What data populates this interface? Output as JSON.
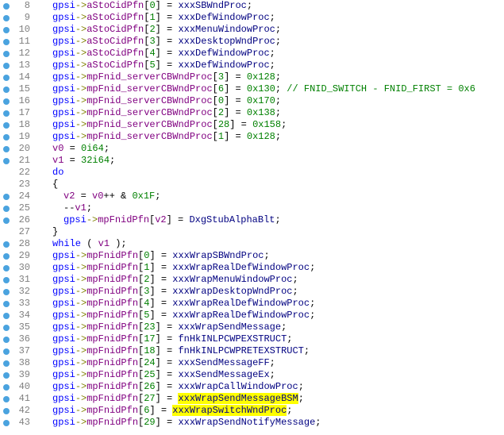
{
  "lines": [
    {
      "n": 8,
      "bp": true,
      "ind": 1,
      "tokens": [
        [
          "g",
          "gpsi"
        ],
        [
          "arr",
          "->"
        ],
        [
          "mem",
          "aStoCidPfn"
        ],
        [
          "op",
          "["
        ],
        [
          "num",
          "0"
        ],
        [
          "op",
          "] = "
        ],
        [
          "fn",
          "xxxSBWndProc"
        ],
        [
          "op",
          ";"
        ]
      ]
    },
    {
      "n": 9,
      "bp": true,
      "ind": 1,
      "tokens": [
        [
          "g",
          "gpsi"
        ],
        [
          "arr",
          "->"
        ],
        [
          "mem",
          "aStoCidPfn"
        ],
        [
          "op",
          "["
        ],
        [
          "num",
          "1"
        ],
        [
          "op",
          "] = "
        ],
        [
          "fn",
          "xxxDefWindowProc"
        ],
        [
          "op",
          ";"
        ]
      ]
    },
    {
      "n": 10,
      "bp": true,
      "ind": 1,
      "tokens": [
        [
          "g",
          "gpsi"
        ],
        [
          "arr",
          "->"
        ],
        [
          "mem",
          "aStoCidPfn"
        ],
        [
          "op",
          "["
        ],
        [
          "num",
          "2"
        ],
        [
          "op",
          "] = "
        ],
        [
          "fn",
          "xxxMenuWindowProc"
        ],
        [
          "op",
          ";"
        ]
      ]
    },
    {
      "n": 11,
      "bp": true,
      "ind": 1,
      "tokens": [
        [
          "g",
          "gpsi"
        ],
        [
          "arr",
          "->"
        ],
        [
          "mem",
          "aStoCidPfn"
        ],
        [
          "op",
          "["
        ],
        [
          "num",
          "3"
        ],
        [
          "op",
          "] = "
        ],
        [
          "fn",
          "xxxDesktopWndProc"
        ],
        [
          "op",
          ";"
        ]
      ]
    },
    {
      "n": 12,
      "bp": true,
      "ind": 1,
      "tokens": [
        [
          "g",
          "gpsi"
        ],
        [
          "arr",
          "->"
        ],
        [
          "mem",
          "aStoCidPfn"
        ],
        [
          "op",
          "["
        ],
        [
          "num",
          "4"
        ],
        [
          "op",
          "] = "
        ],
        [
          "fn",
          "xxxDefWindowProc"
        ],
        [
          "op",
          ";"
        ]
      ]
    },
    {
      "n": 13,
      "bp": true,
      "ind": 1,
      "tokens": [
        [
          "g",
          "gpsi"
        ],
        [
          "arr",
          "->"
        ],
        [
          "mem",
          "aStoCidPfn"
        ],
        [
          "op",
          "["
        ],
        [
          "num",
          "5"
        ],
        [
          "op",
          "] = "
        ],
        [
          "fn",
          "xxxDefWindowProc"
        ],
        [
          "op",
          ";"
        ]
      ]
    },
    {
      "n": 14,
      "bp": true,
      "ind": 1,
      "tokens": [
        [
          "g",
          "gpsi"
        ],
        [
          "arr",
          "->"
        ],
        [
          "mem",
          "mpFnid_serverCBWndProc"
        ],
        [
          "op",
          "["
        ],
        [
          "num",
          "3"
        ],
        [
          "op",
          "] = "
        ],
        [
          "num",
          "0x128"
        ],
        [
          "op",
          ";"
        ]
      ]
    },
    {
      "n": 15,
      "bp": true,
      "ind": 1,
      "tokens": [
        [
          "g",
          "gpsi"
        ],
        [
          "arr",
          "->"
        ],
        [
          "mem",
          "mpFnid_serverCBWndProc"
        ],
        [
          "op",
          "["
        ],
        [
          "num",
          "6"
        ],
        [
          "op",
          "] = "
        ],
        [
          "num",
          "0x130"
        ],
        [
          "op",
          ";"
        ],
        [
          "sp",
          "      "
        ],
        [
          "cm",
          "// FNID_SWITCH - FNID_FIRST = 0x6"
        ]
      ]
    },
    {
      "n": 16,
      "bp": true,
      "ind": 1,
      "tokens": [
        [
          "g",
          "gpsi"
        ],
        [
          "arr",
          "->"
        ],
        [
          "mem",
          "mpFnid_serverCBWndProc"
        ],
        [
          "op",
          "["
        ],
        [
          "num",
          "0"
        ],
        [
          "op",
          "] = "
        ],
        [
          "num",
          "0x170"
        ],
        [
          "op",
          ";"
        ]
      ]
    },
    {
      "n": 17,
      "bp": true,
      "ind": 1,
      "tokens": [
        [
          "g",
          "gpsi"
        ],
        [
          "arr",
          "->"
        ],
        [
          "mem",
          "mpFnid_serverCBWndProc"
        ],
        [
          "op",
          "["
        ],
        [
          "num",
          "2"
        ],
        [
          "op",
          "] = "
        ],
        [
          "num",
          "0x138"
        ],
        [
          "op",
          ";"
        ]
      ]
    },
    {
      "n": 18,
      "bp": true,
      "ind": 1,
      "tokens": [
        [
          "g",
          "gpsi"
        ],
        [
          "arr",
          "->"
        ],
        [
          "mem",
          "mpFnid_serverCBWndProc"
        ],
        [
          "op",
          "["
        ],
        [
          "num",
          "28"
        ],
        [
          "op",
          "] = "
        ],
        [
          "num",
          "0x158"
        ],
        [
          "op",
          ";"
        ]
      ]
    },
    {
      "n": 19,
      "bp": true,
      "ind": 1,
      "tokens": [
        [
          "g",
          "gpsi"
        ],
        [
          "arr",
          "->"
        ],
        [
          "mem",
          "mpFnid_serverCBWndProc"
        ],
        [
          "op",
          "["
        ],
        [
          "num",
          "1"
        ],
        [
          "op",
          "] = "
        ],
        [
          "num",
          "0x128"
        ],
        [
          "op",
          ";"
        ]
      ]
    },
    {
      "n": 20,
      "bp": true,
      "ind": 1,
      "tokens": [
        [
          "var",
          "v0"
        ],
        [
          "op",
          " = "
        ],
        [
          "num",
          "0i64"
        ],
        [
          "op",
          ";"
        ]
      ]
    },
    {
      "n": 21,
      "bp": true,
      "ind": 1,
      "tokens": [
        [
          "var",
          "v1"
        ],
        [
          "op",
          " = "
        ],
        [
          "num",
          "32i64"
        ],
        [
          "op",
          ";"
        ]
      ]
    },
    {
      "n": 22,
      "bp": false,
      "ind": 1,
      "tokens": [
        [
          "kw",
          "do"
        ]
      ]
    },
    {
      "n": 23,
      "bp": false,
      "ind": 1,
      "tokens": [
        [
          "op",
          "{"
        ]
      ]
    },
    {
      "n": 24,
      "bp": true,
      "ind": 2,
      "tokens": [
        [
          "var",
          "v2"
        ],
        [
          "op",
          " = "
        ],
        [
          "var",
          "v0"
        ],
        [
          "op",
          "++ & "
        ],
        [
          "num",
          "0x1F"
        ],
        [
          "op",
          ";"
        ]
      ]
    },
    {
      "n": 25,
      "bp": true,
      "ind": 2,
      "tokens": [
        [
          "op",
          "--"
        ],
        [
          "var",
          "v1"
        ],
        [
          "op",
          ";"
        ]
      ]
    },
    {
      "n": 26,
      "bp": true,
      "ind": 2,
      "tokens": [
        [
          "g",
          "gpsi"
        ],
        [
          "arr",
          "->"
        ],
        [
          "mem",
          "mpFnidPfn"
        ],
        [
          "op",
          "["
        ],
        [
          "var",
          "v2"
        ],
        [
          "op",
          "] = "
        ],
        [
          "fn",
          "DxgStubAlphaBlt"
        ],
        [
          "op",
          ";"
        ]
      ]
    },
    {
      "n": 27,
      "bp": false,
      "ind": 1,
      "tokens": [
        [
          "op",
          "}"
        ]
      ]
    },
    {
      "n": 28,
      "bp": true,
      "ind": 1,
      "tokens": [
        [
          "kw",
          "while"
        ],
        [
          "op",
          " ( "
        ],
        [
          "var",
          "v1"
        ],
        [
          "op",
          " );"
        ]
      ]
    },
    {
      "n": 29,
      "bp": true,
      "ind": 1,
      "tokens": [
        [
          "g",
          "gpsi"
        ],
        [
          "arr",
          "->"
        ],
        [
          "mem",
          "mpFnidPfn"
        ],
        [
          "op",
          "["
        ],
        [
          "num",
          "0"
        ],
        [
          "op",
          "] = "
        ],
        [
          "fn",
          "xxxWrapSBWndProc"
        ],
        [
          "op",
          ";"
        ]
      ]
    },
    {
      "n": 30,
      "bp": true,
      "ind": 1,
      "tokens": [
        [
          "g",
          "gpsi"
        ],
        [
          "arr",
          "->"
        ],
        [
          "mem",
          "mpFnidPfn"
        ],
        [
          "op",
          "["
        ],
        [
          "num",
          "1"
        ],
        [
          "op",
          "] = "
        ],
        [
          "fn",
          "xxxWrapRealDefWindowProc"
        ],
        [
          "op",
          ";"
        ]
      ]
    },
    {
      "n": 31,
      "bp": true,
      "ind": 1,
      "tokens": [
        [
          "g",
          "gpsi"
        ],
        [
          "arr",
          "->"
        ],
        [
          "mem",
          "mpFnidPfn"
        ],
        [
          "op",
          "["
        ],
        [
          "num",
          "2"
        ],
        [
          "op",
          "] = "
        ],
        [
          "fn",
          "xxxWrapMenuWindowProc"
        ],
        [
          "op",
          ";"
        ]
      ]
    },
    {
      "n": 32,
      "bp": true,
      "ind": 1,
      "tokens": [
        [
          "g",
          "gpsi"
        ],
        [
          "arr",
          "->"
        ],
        [
          "mem",
          "mpFnidPfn"
        ],
        [
          "op",
          "["
        ],
        [
          "num",
          "3"
        ],
        [
          "op",
          "] = "
        ],
        [
          "fn",
          "xxxWrapDesktopWndProc"
        ],
        [
          "op",
          ";"
        ]
      ]
    },
    {
      "n": 33,
      "bp": true,
      "ind": 1,
      "tokens": [
        [
          "g",
          "gpsi"
        ],
        [
          "arr",
          "->"
        ],
        [
          "mem",
          "mpFnidPfn"
        ],
        [
          "op",
          "["
        ],
        [
          "num",
          "4"
        ],
        [
          "op",
          "] = "
        ],
        [
          "fn",
          "xxxWrapRealDefWindowProc"
        ],
        [
          "op",
          ";"
        ]
      ]
    },
    {
      "n": 34,
      "bp": true,
      "ind": 1,
      "tokens": [
        [
          "g",
          "gpsi"
        ],
        [
          "arr",
          "->"
        ],
        [
          "mem",
          "mpFnidPfn"
        ],
        [
          "op",
          "["
        ],
        [
          "num",
          "5"
        ],
        [
          "op",
          "] = "
        ],
        [
          "fn",
          "xxxWrapRealDefWindowProc"
        ],
        [
          "op",
          ";"
        ]
      ]
    },
    {
      "n": 35,
      "bp": true,
      "ind": 1,
      "tokens": [
        [
          "g",
          "gpsi"
        ],
        [
          "arr",
          "->"
        ],
        [
          "mem",
          "mpFnidPfn"
        ],
        [
          "op",
          "["
        ],
        [
          "num",
          "23"
        ],
        [
          "op",
          "] = "
        ],
        [
          "fn",
          "xxxWrapSendMessage"
        ],
        [
          "op",
          ";"
        ]
      ]
    },
    {
      "n": 36,
      "bp": true,
      "ind": 1,
      "tokens": [
        [
          "g",
          "gpsi"
        ],
        [
          "arr",
          "->"
        ],
        [
          "mem",
          "mpFnidPfn"
        ],
        [
          "op",
          "["
        ],
        [
          "num",
          "17"
        ],
        [
          "op",
          "] = "
        ],
        [
          "fn",
          "fnHkINLPCWPEXSTRUCT"
        ],
        [
          "op",
          ";"
        ]
      ]
    },
    {
      "n": 37,
      "bp": true,
      "ind": 1,
      "tokens": [
        [
          "g",
          "gpsi"
        ],
        [
          "arr",
          "->"
        ],
        [
          "mem",
          "mpFnidPfn"
        ],
        [
          "op",
          "["
        ],
        [
          "num",
          "18"
        ],
        [
          "op",
          "] = "
        ],
        [
          "fn",
          "fnHkINLPCWPRETEXSTRUCT"
        ],
        [
          "op",
          ";"
        ]
      ]
    },
    {
      "n": 38,
      "bp": true,
      "ind": 1,
      "tokens": [
        [
          "g",
          "gpsi"
        ],
        [
          "arr",
          "->"
        ],
        [
          "mem",
          "mpFnidPfn"
        ],
        [
          "op",
          "["
        ],
        [
          "num",
          "24"
        ],
        [
          "op",
          "] = "
        ],
        [
          "fn",
          "xxxSendMessageFF"
        ],
        [
          "op",
          ";"
        ]
      ]
    },
    {
      "n": 39,
      "bp": true,
      "ind": 1,
      "tokens": [
        [
          "g",
          "gpsi"
        ],
        [
          "arr",
          "->"
        ],
        [
          "mem",
          "mpFnidPfn"
        ],
        [
          "op",
          "["
        ],
        [
          "num",
          "25"
        ],
        [
          "op",
          "] = "
        ],
        [
          "fn",
          "xxxSendMessageEx"
        ],
        [
          "op",
          ";"
        ]
      ]
    },
    {
      "n": 40,
      "bp": true,
      "ind": 1,
      "tokens": [
        [
          "g",
          "gpsi"
        ],
        [
          "arr",
          "->"
        ],
        [
          "mem",
          "mpFnidPfn"
        ],
        [
          "op",
          "["
        ],
        [
          "num",
          "26"
        ],
        [
          "op",
          "] = "
        ],
        [
          "fn",
          "xxxWrapCallWindowProc"
        ],
        [
          "op",
          ";"
        ]
      ]
    },
    {
      "n": 41,
      "bp": true,
      "ind": 1,
      "tokens": [
        [
          "g",
          "gpsi"
        ],
        [
          "arr",
          "->"
        ],
        [
          "mem",
          "mpFnidPfn"
        ],
        [
          "op",
          "["
        ],
        [
          "num",
          "27"
        ],
        [
          "op",
          "] = "
        ],
        [
          "fn hl",
          "xxxWrapSendMessageBSM"
        ],
        [
          "op",
          ";"
        ]
      ]
    },
    {
      "n": 42,
      "bp": true,
      "ind": 1,
      "tokens": [
        [
          "g",
          "gpsi"
        ],
        [
          "arr",
          "->"
        ],
        [
          "mem",
          "mpFnidPfn"
        ],
        [
          "op",
          "["
        ],
        [
          "num",
          "6"
        ],
        [
          "op",
          "] = "
        ],
        [
          "fn hl",
          "xxxWrapSwitchWndProc"
        ],
        [
          "op",
          ";"
        ]
      ]
    },
    {
      "n": 43,
      "bp": true,
      "ind": 1,
      "tokens": [
        [
          "g",
          "gpsi"
        ],
        [
          "arr",
          "->"
        ],
        [
          "mem",
          "mpFnidPfn"
        ],
        [
          "op",
          "["
        ],
        [
          "num",
          "29"
        ],
        [
          "op",
          "] = "
        ],
        [
          "fn",
          "xxxWrapSendNotifyMessage"
        ],
        [
          "op",
          ";"
        ]
      ]
    }
  ]
}
